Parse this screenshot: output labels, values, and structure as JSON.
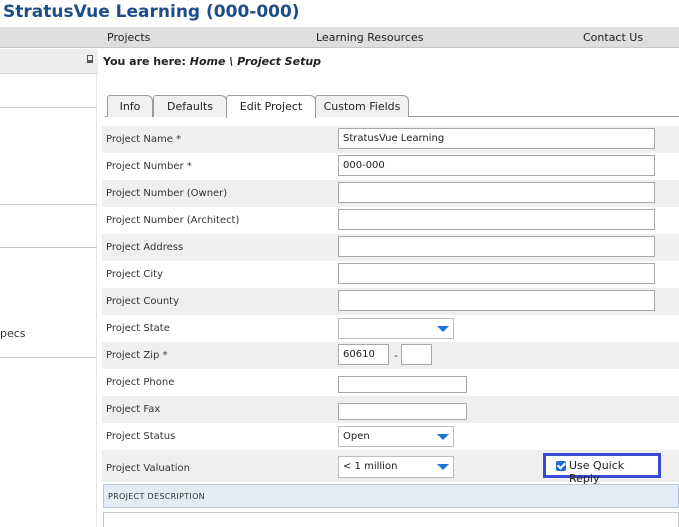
{
  "app": {
    "title": "StratusVue Learning (000-000)"
  },
  "topnav": {
    "items": [
      "Projects",
      "Learning Resources",
      "Contact Us"
    ]
  },
  "breadcrumb": {
    "prefix": "You are here:",
    "home": "Home",
    "sep": "\\",
    "current": "Project Setup"
  },
  "sidebar": {
    "partial_item": "pecs"
  },
  "tabs": [
    {
      "label": "Info",
      "active": false
    },
    {
      "label": "Defaults",
      "active": false
    },
    {
      "label": "Edit Project",
      "active": true
    },
    {
      "label": "Custom Fields",
      "active": false
    }
  ],
  "form": {
    "project_name": {
      "label": "Project Name  *",
      "value": "StratusVue Learning"
    },
    "project_number": {
      "label": "Project Number  *",
      "value": "000-000"
    },
    "project_number_owner": {
      "label": "Project Number (Owner)",
      "value": ""
    },
    "project_number_architect": {
      "label": "Project Number (Architect)",
      "value": ""
    },
    "project_address": {
      "label": "Project Address",
      "value": ""
    },
    "project_city": {
      "label": "Project City",
      "value": ""
    },
    "project_county": {
      "label": "Project County",
      "value": ""
    },
    "project_state": {
      "label": "Project State",
      "value": ""
    },
    "project_zip": {
      "label": "Project Zip  *",
      "value": "60610",
      "ext_value": "",
      "separator": "-"
    },
    "project_phone": {
      "label": "Project Phone",
      "value": ""
    },
    "project_fax": {
      "label": "Project Fax",
      "value": ""
    },
    "project_status": {
      "label": "Project Status",
      "value": "Open"
    },
    "project_valuation": {
      "label": "Project Valuation",
      "value": "< 1 million"
    },
    "quick_reply": {
      "label": "Use Quick Reply",
      "checked": true
    }
  },
  "description": {
    "header": "Project Description"
  },
  "colors": {
    "title": "#1d4e89",
    "accent_blue": "#1a73d9",
    "highlight_border": "#3b4bd1"
  }
}
